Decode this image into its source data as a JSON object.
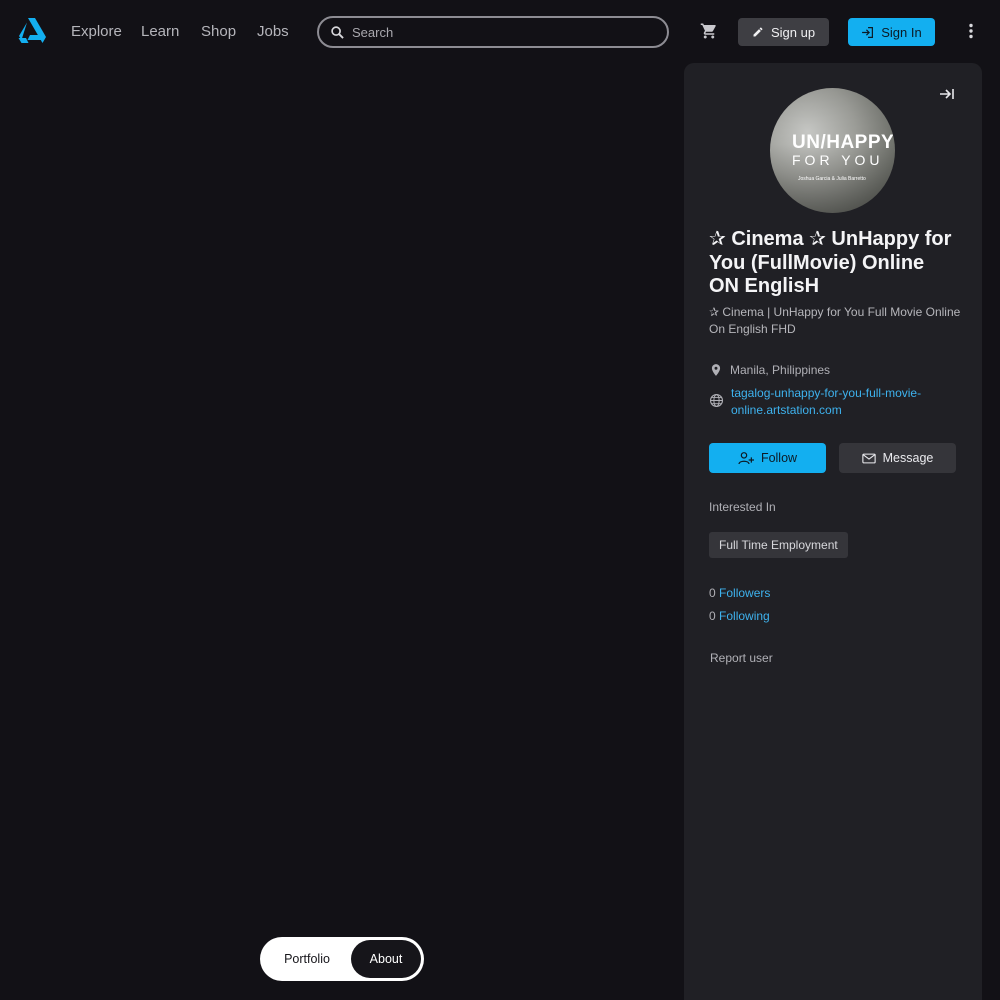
{
  "nav": {
    "links": [
      "Explore",
      "Learn",
      "Shop",
      "Jobs"
    ],
    "search_placeholder": "Search",
    "signup_label": "Sign up",
    "signin_label": "Sign In"
  },
  "profile": {
    "avatar_text": {
      "line1": "UN/HAPPY",
      "line2": "FOR YOU",
      "line3": "Joshua Garcia & Julia Barretto"
    },
    "name": "✰ Cinema ✰ UnHappy for You (FullMovie) Online ON EnglisH",
    "headline": "✰ Cinema | UnHappy for You Full Movie Online On English FHD",
    "location": "Manila, Philippines",
    "website": "tagalog-unhappy-for-you-full-movie-online.artstation.com",
    "follow_label": "Follow",
    "message_label": "Message",
    "interested_label": "Interested In",
    "interests": [
      "Full Time Employment"
    ],
    "followers_count": "0",
    "followers_label": "Followers",
    "following_count": "0",
    "following_label": "Following",
    "report_label": "Report user"
  },
  "tabs": {
    "portfolio": "Portfolio",
    "about": "About"
  },
  "colors": {
    "background": "#121116",
    "panel": "#202025",
    "accent": "#13aff0",
    "link": "#3eb2ee"
  }
}
